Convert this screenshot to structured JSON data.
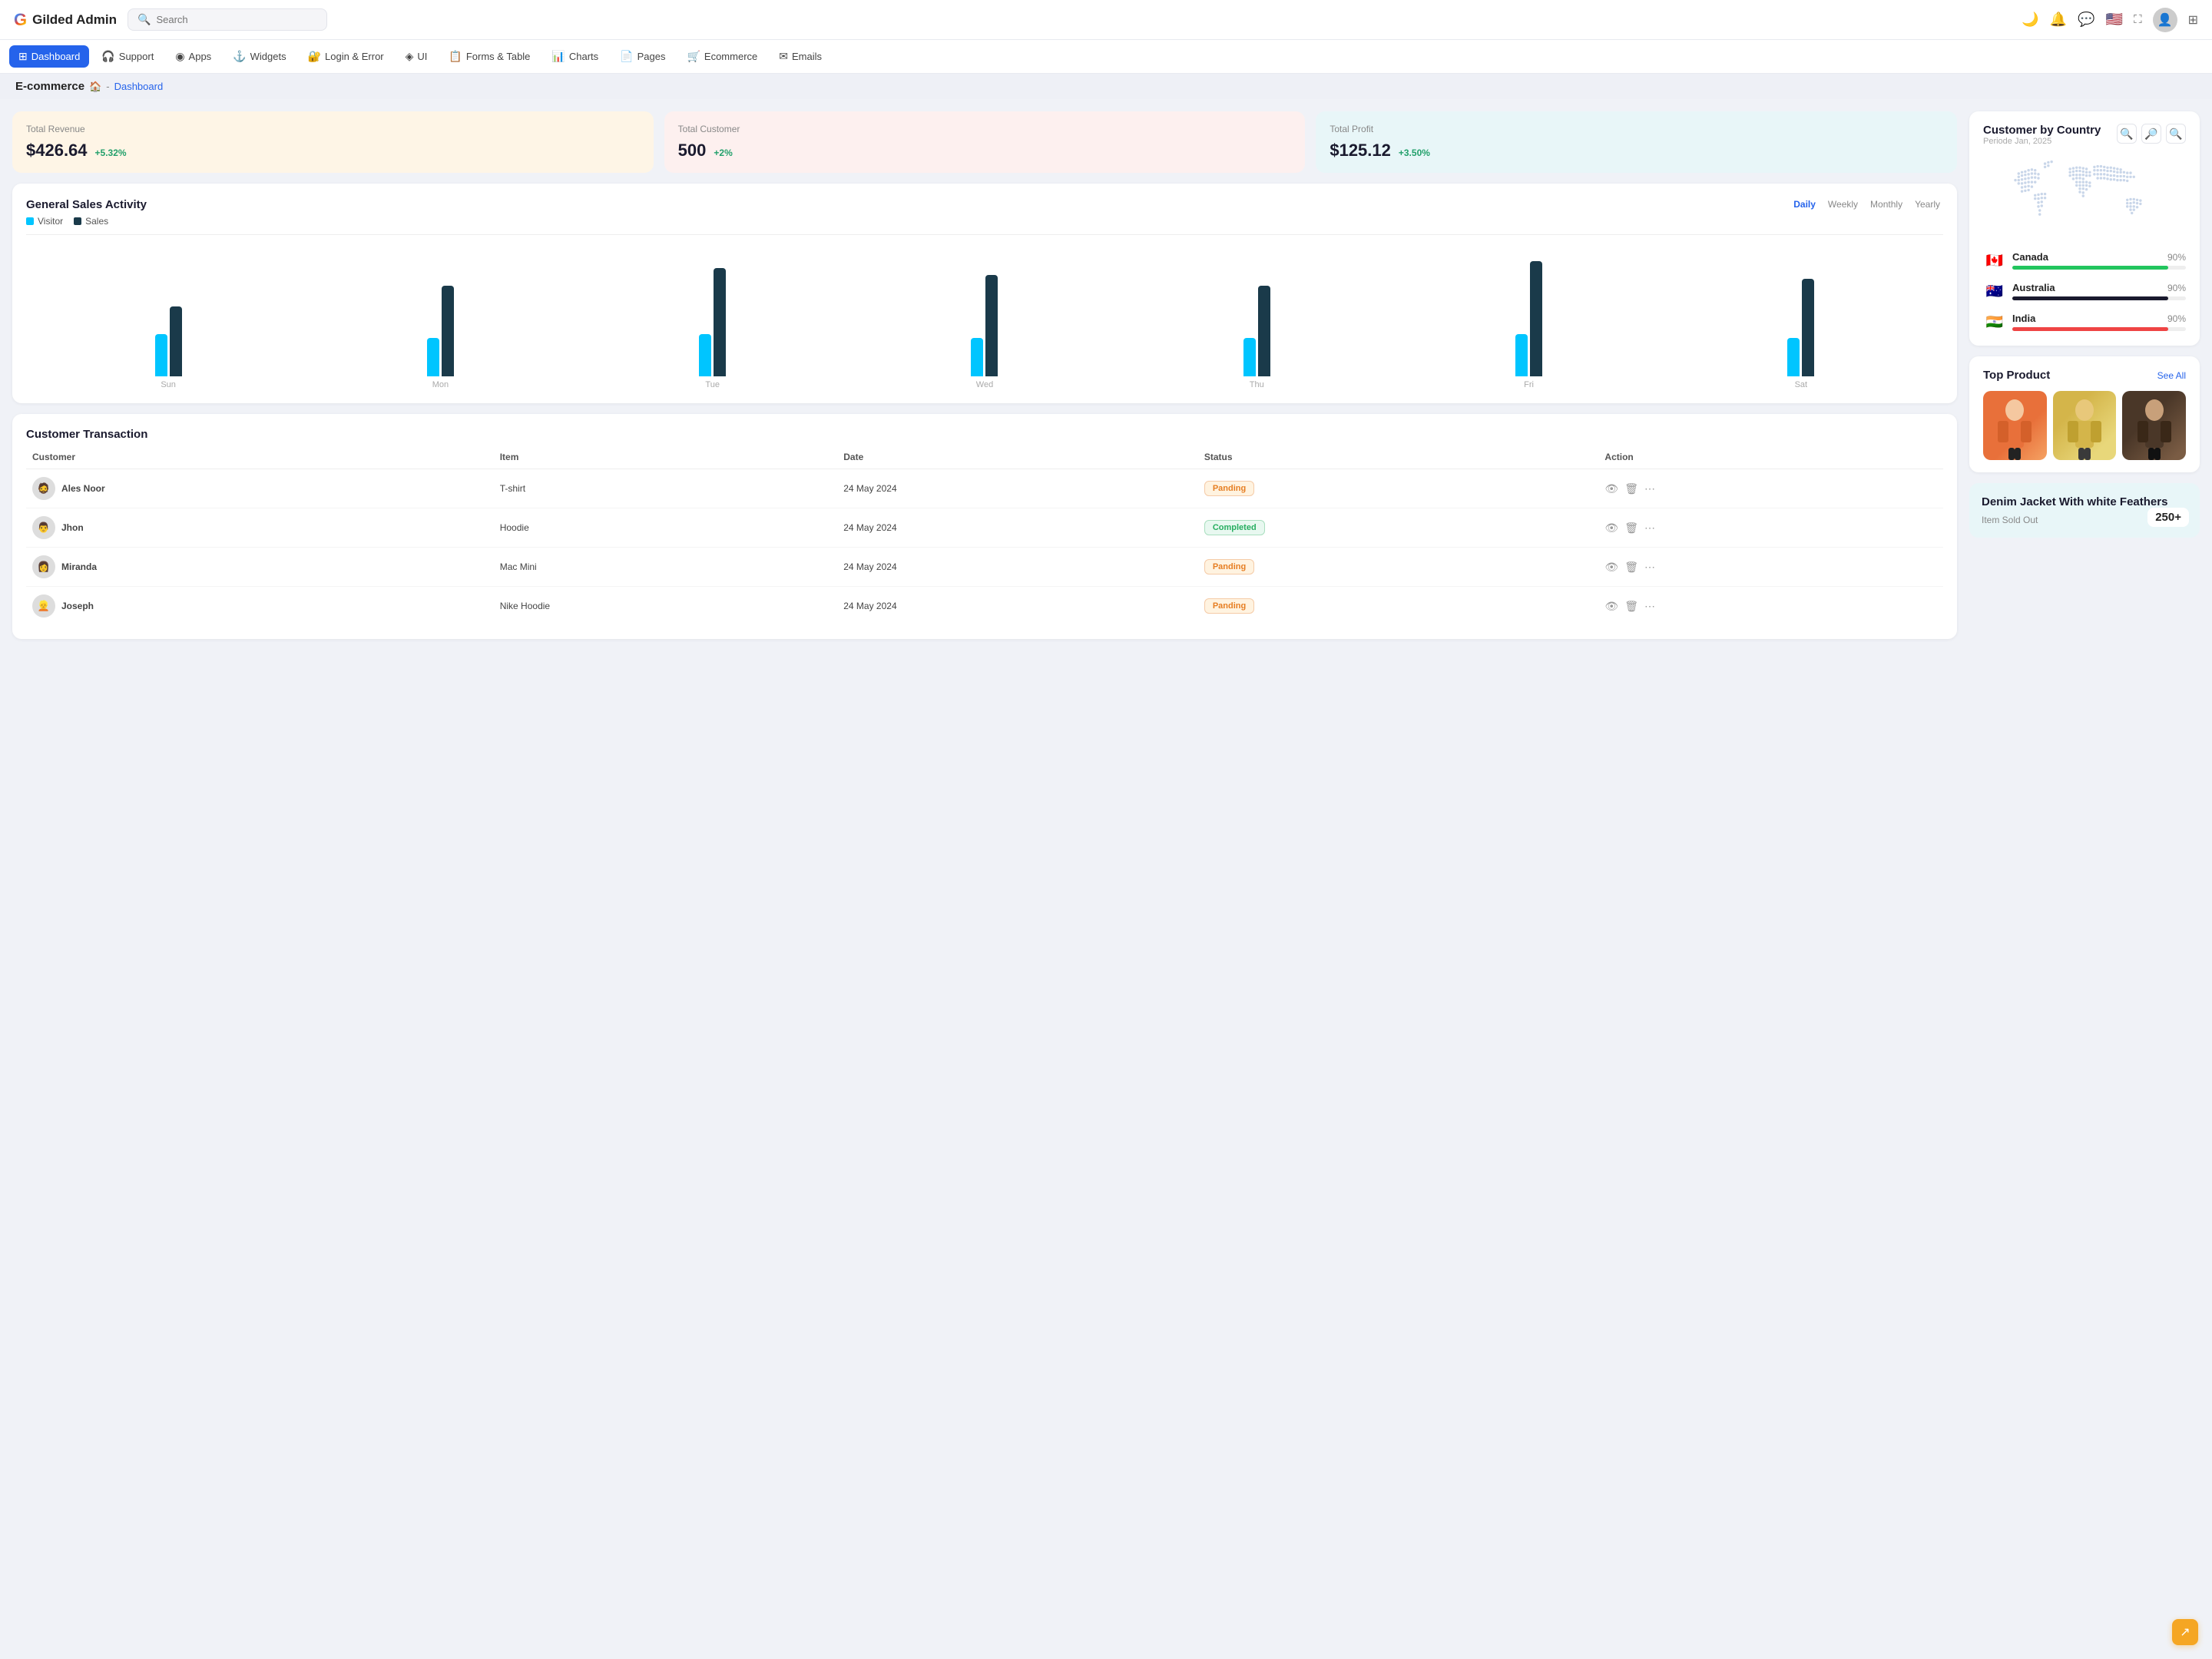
{
  "logo": {
    "letter": "G",
    "appname": "Gilded Admin"
  },
  "search": {
    "placeholder": "Search"
  },
  "topbar_icons": [
    "🌙",
    "🔔",
    "💬",
    "🇺🇸",
    "⊞"
  ],
  "mainnav": {
    "items": [
      {
        "id": "dashboard",
        "icon": "⊞",
        "label": "Dashboard",
        "active": true
      },
      {
        "id": "support",
        "icon": "🎧",
        "label": "Support",
        "active": false
      },
      {
        "id": "apps",
        "icon": "◉",
        "label": "Apps",
        "active": false
      },
      {
        "id": "widgets",
        "icon": "⚓",
        "label": "Widgets",
        "active": false
      },
      {
        "id": "login-error",
        "icon": "🔐",
        "label": "Login & Error",
        "active": false
      },
      {
        "id": "ui",
        "icon": "◈",
        "label": "UI",
        "active": false
      },
      {
        "id": "forms-table",
        "icon": "📋",
        "label": "Forms & Table",
        "active": false
      },
      {
        "id": "charts",
        "icon": "📊",
        "label": "Charts",
        "active": false
      },
      {
        "id": "pages",
        "icon": "📄",
        "label": "Pages",
        "active": false
      },
      {
        "id": "ecommerce",
        "icon": "🛒",
        "label": "Ecommerce",
        "active": false
      },
      {
        "id": "emails",
        "icon": "✉",
        "label": "Emails",
        "active": false
      }
    ]
  },
  "breadcrumb": {
    "section": "E-commerce",
    "home_icon": "🏠",
    "path": "Dashboard"
  },
  "stats": {
    "revenue": {
      "label": "Total Revenue",
      "value": "$426.64",
      "change": "+5.32%"
    },
    "customers": {
      "label": "Total Customer",
      "value": "500",
      "change": "+2%"
    },
    "profit": {
      "label": "Total Profit",
      "value": "$125.12",
      "change": "+3.50%"
    }
  },
  "sales_chart": {
    "title": "General Sales Activity",
    "legend": {
      "visitor": "Visitor",
      "sales": "Sales"
    },
    "filters": [
      "Daily",
      "Weekly",
      "Monthly",
      "Yearly"
    ],
    "active_filter": "Daily",
    "days": [
      "Sun",
      "Mon",
      "Tue",
      "Wed",
      "Thu",
      "Fri",
      "Sat"
    ],
    "visitor_heights": [
      60,
      55,
      60,
      55,
      55,
      60,
      55
    ],
    "sales_heights": [
      100,
      130,
      155,
      145,
      130,
      165,
      140
    ]
  },
  "transactions": {
    "title": "Customer Transaction",
    "columns": [
      "Customer",
      "Item",
      "Date",
      "Status",
      "Action"
    ],
    "rows": [
      {
        "name": "Ales Noor",
        "item": "T-shirt",
        "date": "24 May 2024",
        "status": "Panding",
        "status_type": "pending"
      },
      {
        "name": "Jhon",
        "item": "Hoodie",
        "date": "24 May 2024",
        "status": "Completed",
        "status_type": "completed"
      },
      {
        "name": "Miranda",
        "item": "Mac Mini",
        "date": "24 May 2024",
        "status": "Panding",
        "status_type": "pending"
      },
      {
        "name": "Joseph",
        "item": "Nike Hoodie",
        "date": "24 May 2024",
        "status": "Panding",
        "status_type": "pending"
      }
    ]
  },
  "customer_by_country": {
    "title": "Customer by Country",
    "subtitle": "Periode Jan, 2025",
    "countries": [
      {
        "name": "Canada",
        "pct": 90,
        "pct_label": "90%",
        "flag": "🇨🇦",
        "bar_color": "#22c55e"
      },
      {
        "name": "Australia",
        "pct": 90,
        "pct_label": "90%",
        "flag": "🇦🇺",
        "bar_color": "#1a1a2e"
      },
      {
        "name": "India",
        "pct": 90,
        "pct_label": "90%",
        "flag": "🇮🇳",
        "bar_color": "#ef4444"
      }
    ]
  },
  "top_product": {
    "title": "Top Product",
    "see_all": "See All",
    "featured": {
      "title": "Denim Jacket With white Feathers",
      "sold_label": "Item Sold Out",
      "count": "250+"
    }
  }
}
